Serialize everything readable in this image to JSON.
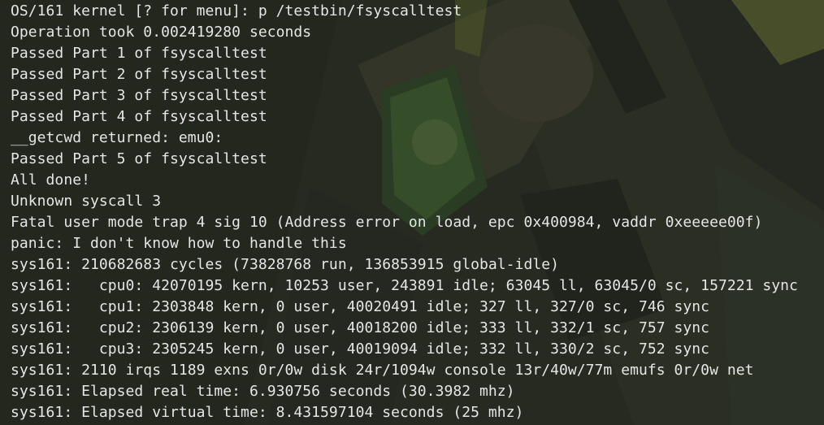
{
  "terminal": {
    "lines": [
      "OS/161 kernel [? for menu]: p /testbin/fsyscalltest",
      "Operation took 0.002419280 seconds",
      "Passed Part 1 of fsyscalltest",
      "Passed Part 2 of fsyscalltest",
      "Passed Part 3 of fsyscalltest",
      "Passed Part 4 of fsyscalltest",
      "__getcwd returned: emu0:",
      "Passed Part 5 of fsyscalltest",
      "All done!",
      "Unknown syscall 3",
      "Fatal user mode trap 4 sig 10 (Address error on load, epc 0x400984, vaddr 0xeeeee00f)",
      "panic: I don't know how to handle this",
      "sys161: 210682683 cycles (73828768 run, 136853915 global-idle)",
      "sys161:   cpu0: 42070195 kern, 10253 user, 243891 idle; 63045 ll, 63045/0 sc, 157221 sync",
      "sys161:   cpu1: 2303848 kern, 0 user, 40020491 idle; 327 ll, 327/0 sc, 746 sync",
      "sys161:   cpu2: 2306139 kern, 0 user, 40018200 idle; 333 ll, 332/1 sc, 757 sync",
      "sys161:   cpu3: 2305245 kern, 0 user, 40019094 idle; 332 ll, 330/2 sc, 752 sync",
      "sys161: 2110 irqs 1189 exns 0r/0w disk 24r/1094w console 13r/40w/77m emufs 0r/0w net",
      "sys161: Elapsed real time: 6.930756 seconds (30.3982 mhz)",
      "sys161: Elapsed virtual time: 8.431597104 seconds (25 mhz)"
    ]
  },
  "colors": {
    "text": "#e6e6e6",
    "background": "#2f3327"
  }
}
